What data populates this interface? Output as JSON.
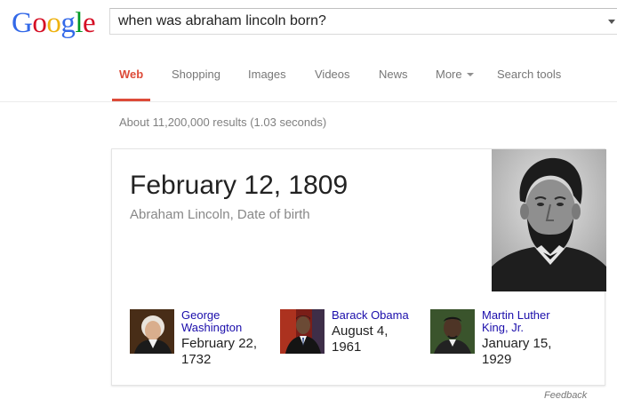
{
  "logo": {
    "letters": [
      "G",
      "o",
      "o",
      "g",
      "l",
      "e"
    ],
    "colors": [
      "#3369e8",
      "#d50f25",
      "#eeb211",
      "#3369e8",
      "#009925",
      "#d50f25"
    ]
  },
  "search": {
    "query": "when was abraham lincoln born?"
  },
  "tabs": {
    "web": "Web",
    "shopping": "Shopping",
    "images": "Images",
    "videos": "Videos",
    "news": "News",
    "more": "More",
    "search_tools": "Search tools",
    "active_color": "#dd4b39"
  },
  "result_stats": "About 11,200,000 results (1.03 seconds)",
  "answer_card": {
    "date": "February 12, 1809",
    "subtitle": "Abraham Lincoln, Date of birth",
    "main_image_icon": "abraham-lincoln-portrait",
    "related": [
      {
        "name_line1": "George",
        "name_line2": "Washington",
        "date_line1": "February 22,",
        "date_line2": "1732",
        "icon": "george-washington-portrait"
      },
      {
        "name_line1": "Barack Obama",
        "name_line2": "",
        "date_line1": "August 4,",
        "date_line2": "1961",
        "icon": "barack-obama-portrait"
      },
      {
        "name_line1": "Martin Luther",
        "name_line2": "King, Jr.",
        "date_line1": "January 15,",
        "date_line2": "1929",
        "icon": "martin-luther-king-portrait"
      }
    ]
  },
  "feedback": "Feedback",
  "link_color": "#1a0dab"
}
